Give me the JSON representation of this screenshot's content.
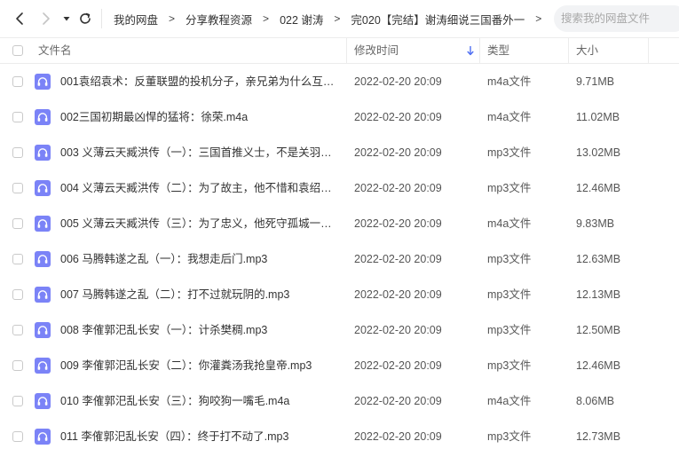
{
  "toolbar": {
    "breadcrumb": [
      "我的网盘",
      "分享教程资源",
      "022 谢涛",
      "完020【完结】谢涛细说三国番外一"
    ],
    "separator": ">",
    "search_placeholder": "搜索我的网盘文件"
  },
  "columns": {
    "name": "文件名",
    "modified": "修改时间",
    "type": "类型",
    "size": "大小"
  },
  "accent_color": "#4e6ef2",
  "icon_color": "#7b83f7",
  "files": [
    {
      "name": "001袁绍袁术：反董联盟的投机分子，亲兄弟为什么互撕...",
      "date": "2022-02-20 20:09",
      "type": "m4a文件",
      "size": "9.71MB"
    },
    {
      "name": "002三国初期最凶悍的猛将：徐荣.m4a",
      "date": "2022-02-20 20:09",
      "type": "m4a文件",
      "size": "11.02MB"
    },
    {
      "name": "003 义薄云天臧洪传（一）：三国首推义士，不是关羽，...",
      "date": "2022-02-20 20:09",
      "type": "mp3文件",
      "size": "13.02MB"
    },
    {
      "name": "004 义薄云天臧洪传（二）：为了故主，他不惜和袁绍翻...",
      "date": "2022-02-20 20:09",
      "type": "mp3文件",
      "size": "12.46MB"
    },
    {
      "name": "005 义薄云天臧洪传（三）：为了忠义，他死守孤城一年...",
      "date": "2022-02-20 20:09",
      "type": "m4a文件",
      "size": "9.83MB"
    },
    {
      "name": "006 马腾韩遂之乱（一）：我想走后门.mp3",
      "date": "2022-02-20 20:09",
      "type": "mp3文件",
      "size": "12.63MB"
    },
    {
      "name": "007 马腾韩遂之乱（二）：打不过就玩阴的.mp3",
      "date": "2022-02-20 20:09",
      "type": "mp3文件",
      "size": "12.13MB"
    },
    {
      "name": "008 李傕郭汜乱长安（一）：计杀樊稠.mp3",
      "date": "2022-02-20 20:09",
      "type": "mp3文件",
      "size": "12.50MB"
    },
    {
      "name": "009 李傕郭汜乱长安（二）：你灌粪汤我抢皇帝.mp3",
      "date": "2022-02-20 20:09",
      "type": "mp3文件",
      "size": "12.46MB"
    },
    {
      "name": "010 李傕郭汜乱长安（三）：狗咬狗一嘴毛.m4a",
      "date": "2022-02-20 20:09",
      "type": "m4a文件",
      "size": "8.06MB"
    },
    {
      "name": "011 李傕郭汜乱长安（四）：终于打不动了.mp3",
      "date": "2022-02-20 20:09",
      "type": "mp3文件",
      "size": "12.73MB"
    }
  ]
}
